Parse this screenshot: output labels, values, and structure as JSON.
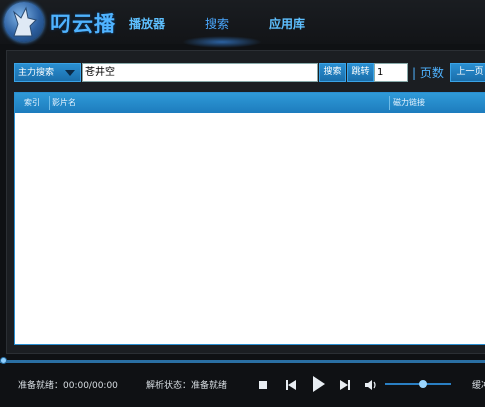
{
  "app": {
    "title": "叼云播"
  },
  "nav": {
    "items": [
      {
        "label": "播放器"
      },
      {
        "label": "搜索"
      },
      {
        "label": "应用库"
      }
    ]
  },
  "search": {
    "type_selected": "主力搜索",
    "query_value": "苍井空",
    "search_button": "搜索",
    "jump_button": "跳转",
    "page_value": "1",
    "page_label": "| 页数",
    "prev_button": "上一页"
  },
  "table": {
    "columns": [
      "索引",
      "影片名",
      "磁力链接"
    ],
    "rows": []
  },
  "player": {
    "status_ready": "准备就绪：00:00/00:00",
    "parse_status": "解析状态：准备就绪",
    "buffer_label": "缓冲"
  },
  "colors": {
    "accent": "#1d7cbd",
    "background": "#0f1114",
    "panel": "#1b1e22"
  },
  "icons": [
    "wolf-logo-icon",
    "stop-icon",
    "previous-icon",
    "play-icon",
    "next-icon",
    "volume-icon",
    "dropdown-arrow-icon"
  ]
}
